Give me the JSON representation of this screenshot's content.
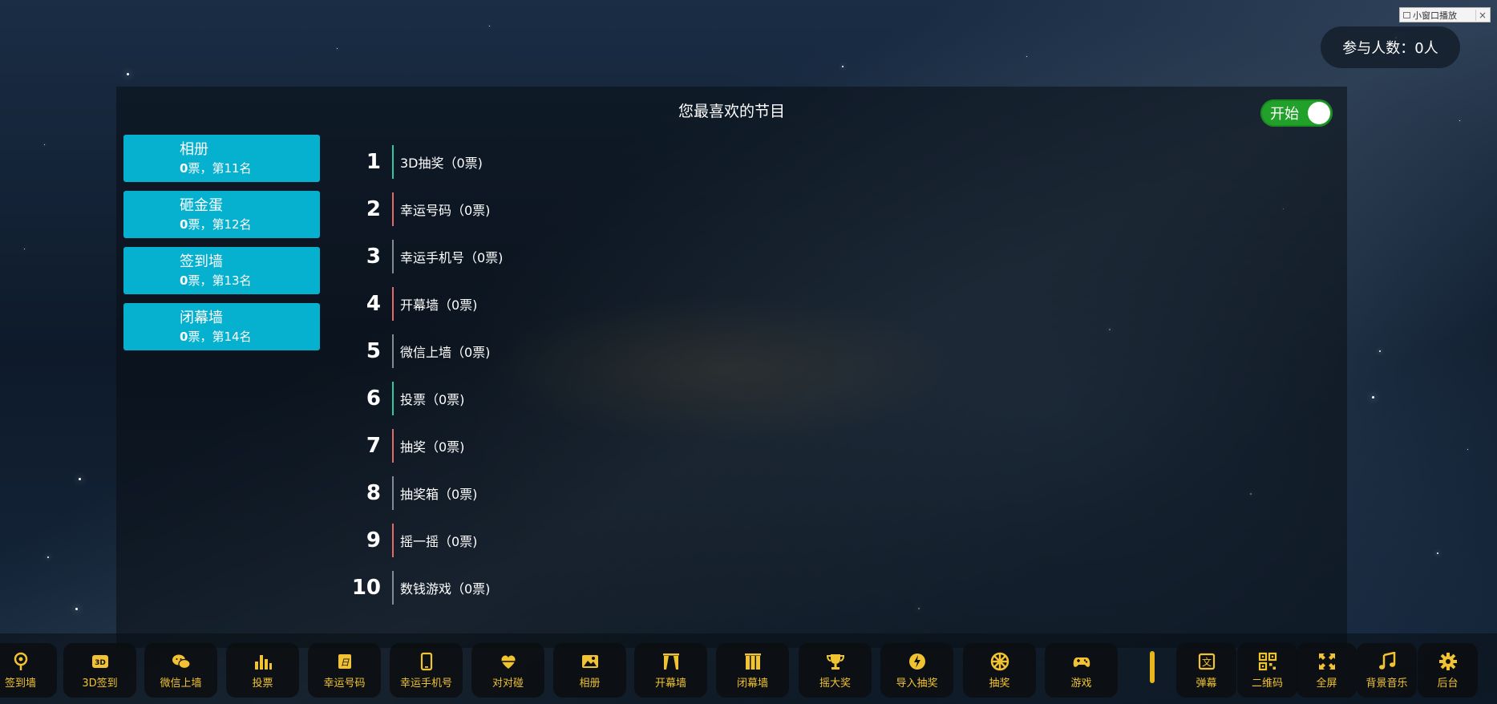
{
  "mini_window": {
    "label": "小窗口播放",
    "close": "×"
  },
  "participants": {
    "text": "参与人数：0人"
  },
  "panel": {
    "title": "您最喜欢的节目",
    "toggle_label": "开始"
  },
  "cards": [
    {
      "name": "相册",
      "votes": "0",
      "suffix": "票，第11名"
    },
    {
      "name": "砸金蛋",
      "votes": "0",
      "suffix": "票，第12名"
    },
    {
      "name": "签到墙",
      "votes": "0",
      "suffix": "票，第13名"
    },
    {
      "name": "闭幕墙",
      "votes": "0",
      "suffix": "票，第14名"
    }
  ],
  "ranking": [
    {
      "num": "1",
      "text": "3D抽奖（0票)",
      "color": "#2ec9a4"
    },
    {
      "num": "2",
      "text": "幸运号码（0票)",
      "color": "#e46a6a"
    },
    {
      "num": "3",
      "text": "幸运手机号（0票)",
      "color": "#7f8c96"
    },
    {
      "num": "4",
      "text": "开幕墙（0票)",
      "color": "#e46a6a"
    },
    {
      "num": "5",
      "text": "微信上墙（0票)",
      "color": "#7f8c96"
    },
    {
      "num": "6",
      "text": "投票（0票)",
      "color": "#2ec9a4"
    },
    {
      "num": "7",
      "text": "抽奖（0票)",
      "color": "#e46a6a"
    },
    {
      "num": "8",
      "text": "抽奖箱（0票)",
      "color": "#7f8c96"
    },
    {
      "num": "9",
      "text": "摇一摇（0票)",
      "color": "#e46a6a"
    },
    {
      "num": "10",
      "text": "数钱游戏（0票)",
      "color": "#7f8c96"
    }
  ],
  "toolbar": [
    {
      "label": "签到墙",
      "icon": "sign-in-icon"
    },
    {
      "label": "3D签到",
      "icon": "3d-icon"
    },
    {
      "label": "微信上墙",
      "icon": "wechat-icon"
    },
    {
      "label": "投票",
      "icon": "bar-chart-icon"
    },
    {
      "label": "幸运号码",
      "icon": "lucky-number-icon"
    },
    {
      "label": "幸运手机号",
      "icon": "phone-icon"
    },
    {
      "label": "对对碰",
      "icon": "hearts-icon"
    },
    {
      "label": "相册",
      "icon": "photo-icon"
    },
    {
      "label": "开幕墙",
      "icon": "curtain-open-icon"
    },
    {
      "label": "闭幕墙",
      "icon": "curtain-closed-icon"
    },
    {
      "label": "摇大奖",
      "icon": "trophy-icon"
    },
    {
      "label": "导入抽奖",
      "icon": "import-lottery-icon"
    },
    {
      "label": "抽奖",
      "icon": "wheel-icon"
    },
    {
      "label": "游戏",
      "icon": "gamepad-icon"
    },
    {
      "label": "弹幕",
      "icon": "danmaku-icon"
    },
    {
      "label": "二维码",
      "icon": "qrcode-icon"
    },
    {
      "label": "全屏",
      "icon": "fullscreen-icon"
    },
    {
      "label": "背景音乐",
      "icon": "music-icon"
    },
    {
      "label": "后台",
      "icon": "gear-icon"
    }
  ],
  "colors": {
    "card_bg": "#06b0cf",
    "toggle_bg": "#22a12a",
    "toolbar_accent": "#f1c232"
  }
}
